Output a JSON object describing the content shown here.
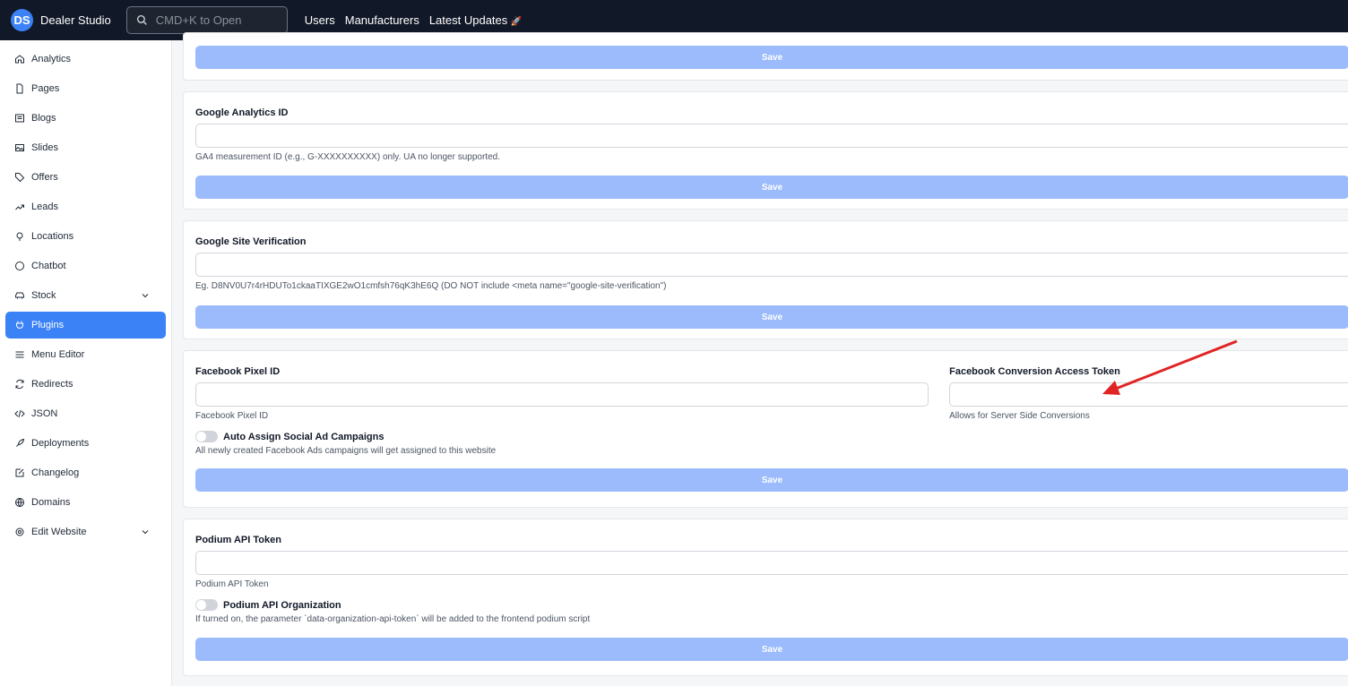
{
  "header": {
    "logo": "DS",
    "brand": "Dealer Studio",
    "search_placeholder": "CMD+K to Open",
    "nav": [
      "Users",
      "Manufacturers",
      "Latest Updates"
    ]
  },
  "sidebar": {
    "items": [
      {
        "label": "Analytics",
        "icon": "home-icon"
      },
      {
        "label": "Pages",
        "icon": "file-icon"
      },
      {
        "label": "Blogs",
        "icon": "list-icon"
      },
      {
        "label": "Slides",
        "icon": "image-icon"
      },
      {
        "label": "Offers",
        "icon": "tag-icon"
      },
      {
        "label": "Leads",
        "icon": "trend-icon"
      },
      {
        "label": "Locations",
        "icon": "pin-icon"
      },
      {
        "label": "Chatbot",
        "icon": "chat-icon"
      },
      {
        "label": "Stock",
        "icon": "car-icon"
      },
      {
        "label": "Plugins",
        "icon": "plug-icon"
      },
      {
        "label": "Menu Editor",
        "icon": "menu-icon"
      },
      {
        "label": "Redirects",
        "icon": "refresh-icon"
      },
      {
        "label": "JSON",
        "icon": "code-icon"
      },
      {
        "label": "Deployments",
        "icon": "rocket-icon"
      },
      {
        "label": "Changelog",
        "icon": "edit-icon"
      },
      {
        "label": "Domains",
        "icon": "globe-icon"
      },
      {
        "label": "Edit Website",
        "icon": "gear-icon"
      }
    ],
    "active": "Plugins"
  },
  "save_label": "Save",
  "ga": {
    "label": "Google Analytics ID",
    "value": "",
    "help": "GA4 measurement ID (e.g., G-XXXXXXXXXX) only. UA no longer supported."
  },
  "gsv": {
    "label": "Google Site Verification",
    "value": "",
    "help": "Eg. D8NV0U7r4rHDUTo1ckaaTIXGE2wO1cmfsh76qK3hE6Q (DO NOT include <meta name=\"google-site-verification\")"
  },
  "fb": {
    "pixel_label": "Facebook Pixel ID",
    "pixel_value": "",
    "pixel_help": "Facebook Pixel ID",
    "token_label": "Facebook Conversion Access Token",
    "token_value": "",
    "token_help": "Allows for Server Side Conversions",
    "toggle_label": "Auto Assign Social Ad Campaigns",
    "toggle_on": false,
    "toggle_help": "All newly created Facebook Ads campaigns will get assigned to this website"
  },
  "podium": {
    "label": "Podium API Token",
    "value": "",
    "help": "Podium API Token",
    "toggle_label": "Podium API Organization",
    "toggle_on": false,
    "toggle_help": "If turned on, the parameter `data-organization-api-token` will be added to the frontend podium script"
  },
  "colors": {
    "accent": "#3b82f6",
    "save": "#9bbbfc",
    "header": "#111827",
    "annotation": "#e02424"
  }
}
